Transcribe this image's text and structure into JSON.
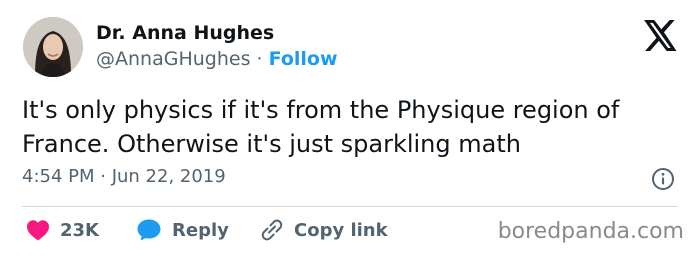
{
  "author": {
    "name": "Dr. Anna Hughes",
    "handle": "@AnnaGHughes",
    "separator": "·",
    "follow_label": "Follow"
  },
  "tweet": {
    "text": "It's only physics if it's from the Physique region of France. Otherwise it's just sparkling math",
    "timestamp": "4:54 PM · Jun 22, 2019"
  },
  "actions": {
    "like_count": "23K",
    "reply_label": "Reply",
    "copy_link_label": "Copy link"
  },
  "watermark": "boredpanda.com",
  "icons": {
    "logo": "x-logo-icon",
    "info": "info-icon",
    "like": "heart-icon",
    "reply": "speech-bubble-icon",
    "copy": "link-icon"
  },
  "colors": {
    "accent": "#1d9bf0",
    "like": "#f91880",
    "secondary_text": "#536471"
  }
}
